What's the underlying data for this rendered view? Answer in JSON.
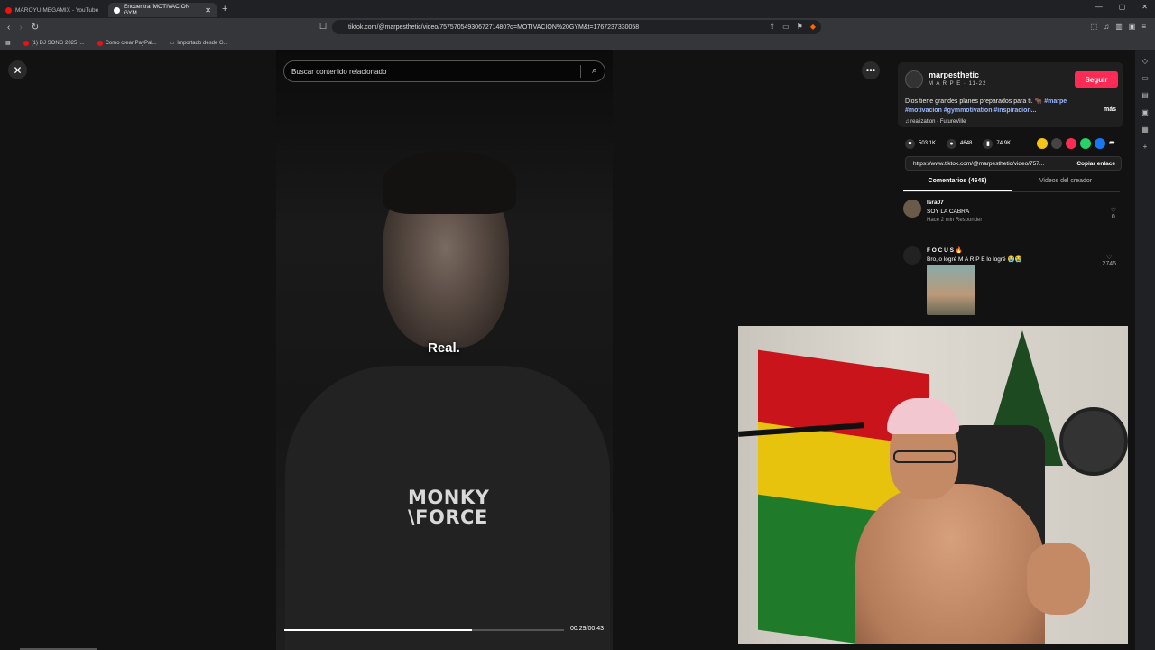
{
  "browser": {
    "tabs": [
      {
        "label": "MAROYU MEGAMIX - YouTube"
      },
      {
        "label": "Encuentra 'MOTIVACION GYM"
      }
    ],
    "new_tab": "+",
    "window_controls": [
      "—",
      "▢",
      "✕"
    ],
    "url": "tiktok.com/@marpesthetic/video/7575705493067271480?q=MOTIVACION%20GYM&t=1767237330058",
    "bookmarks": [
      {
        "label": "(1) DJ SONG 2025 |..."
      },
      {
        "label": "Como crear PayPal..."
      },
      {
        "label": "Importado desde G..."
      }
    ]
  },
  "tiktok": {
    "search_placeholder": "Buscar contenido relacionado",
    "caption_overlay": "Real.",
    "shirt_brand_line1": "MONKY",
    "shirt_brand_line2": "\\FORCE",
    "progress_fraction": 0.67,
    "time": "00:29/00:43",
    "profile": {
      "username": "marpesthetic",
      "subtitle": "M A R P E · 11-22",
      "follow_label": "Seguir",
      "description": "Dios tiene grandes planes preparados para ti. 🐂",
      "tags": "#marpe #motivacion #gymmotivation #inspiracion...",
      "more_label": "más",
      "music": "realization - FutureVille"
    },
    "stats": {
      "likes": "503.1K",
      "comments": "4648",
      "saves": "74.9K"
    },
    "link": {
      "url": "https://www.tiktok.com/@marpesthetic/video/757...",
      "copy_label": "Copiar enlace"
    },
    "tabs": {
      "comments": "Comentarios (4648)",
      "creator_videos": "Videos del creador"
    },
    "comments": [
      {
        "user": "Isra07",
        "text": "SOY LA CABRA",
        "meta": "Hace 2 min   Responder",
        "likes": "0"
      },
      {
        "user": "F O C U S 🔥",
        "text": "Bro,lo logré M A R P E lo logré 😭😭",
        "likes": "2746"
      }
    ]
  },
  "colors": {
    "accent": "#fe2c55",
    "tag": "#9bb8ff",
    "page_bg": "#121212"
  }
}
